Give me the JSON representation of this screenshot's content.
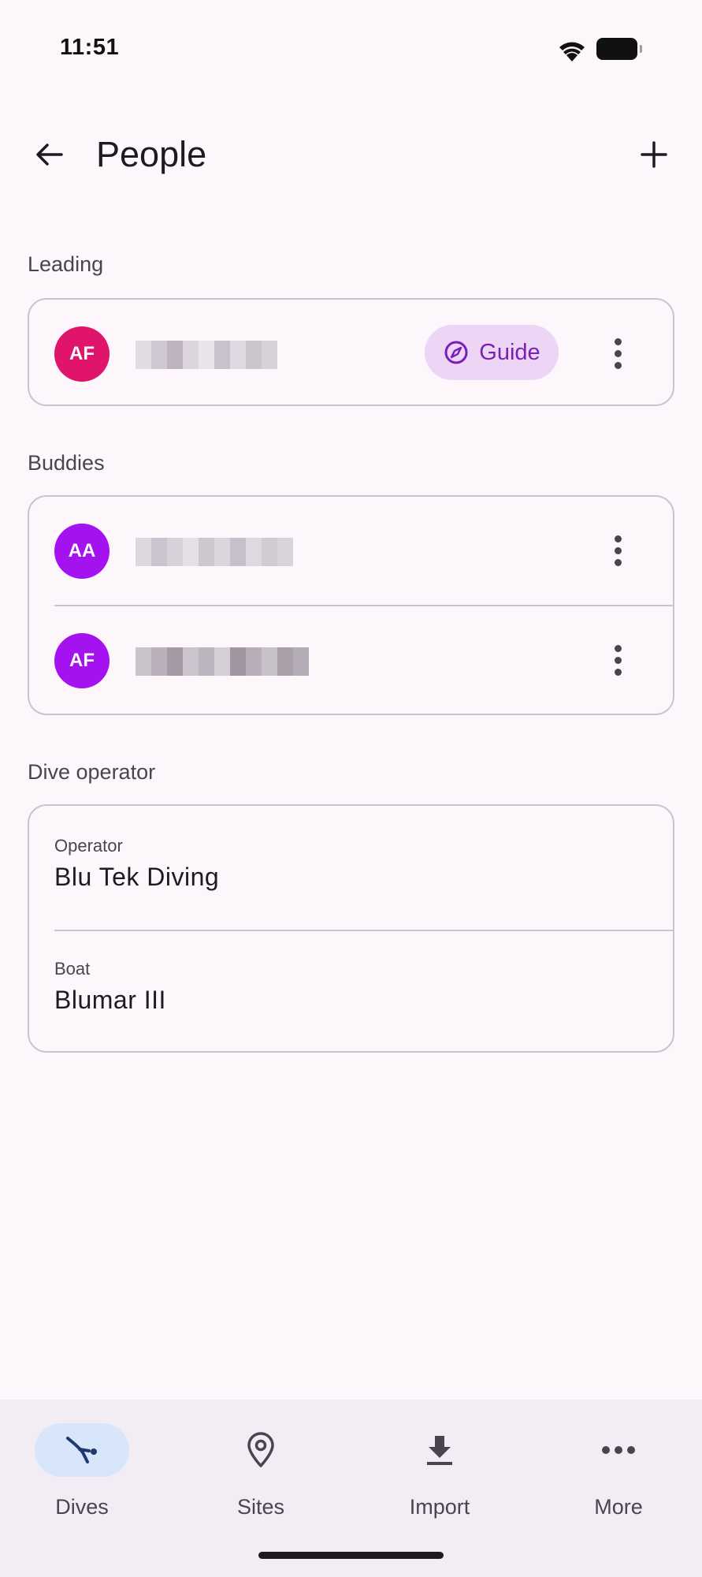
{
  "status_bar": {
    "time": "11:51"
  },
  "app_bar": {
    "title": "People"
  },
  "leading": {
    "header": "Leading",
    "person": {
      "initials": "AF",
      "avatar_color": "#e0146b",
      "role_chip": "Guide"
    }
  },
  "buddies": {
    "header": "Buddies",
    "people": [
      {
        "initials": "AA",
        "avatar_color": "#a412ef"
      },
      {
        "initials": "AF",
        "avatar_color": "#a412ef"
      }
    ]
  },
  "dive_operator": {
    "header": "Dive operator",
    "operator_label": "Operator",
    "operator_value": "Blu Tek Diving",
    "boat_label": "Boat",
    "boat_value": "Blumar III"
  },
  "bottom_nav": {
    "items": [
      {
        "label": "Dives",
        "icon": "diver-icon",
        "active": true
      },
      {
        "label": "Sites",
        "icon": "location-pin-icon",
        "active": false
      },
      {
        "label": "Import",
        "icon": "download-icon",
        "active": false
      },
      {
        "label": "More",
        "icon": "more-horizontal-icon",
        "active": false
      }
    ]
  },
  "colors": {
    "background": "#fdf7fc",
    "chip_background": "#ecd5f5",
    "chip_text": "#7a1fb8",
    "nav_background": "#f2ecf5",
    "active_pill": "#d8e6fb"
  }
}
